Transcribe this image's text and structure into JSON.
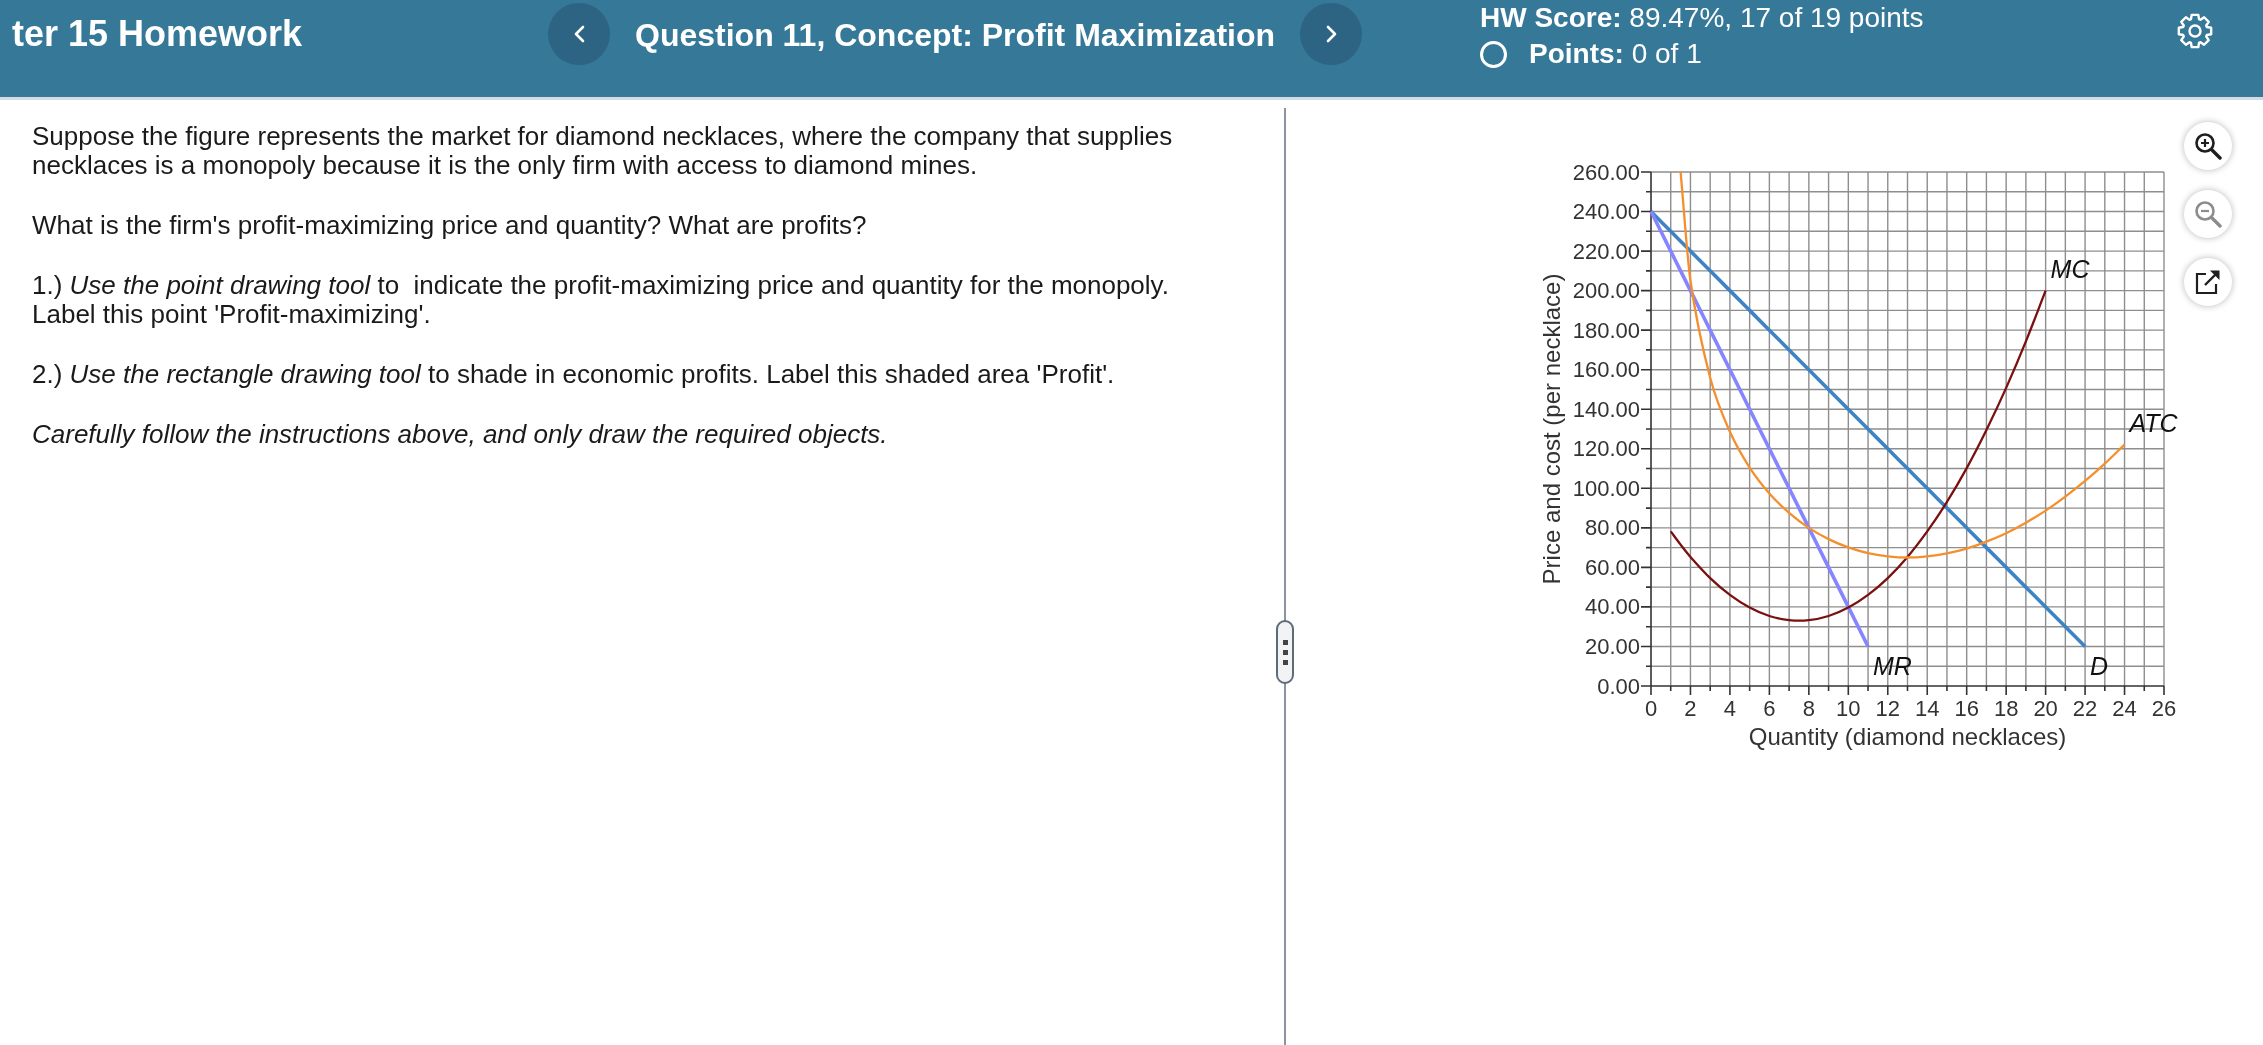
{
  "header": {
    "assignment_title": "ter 15 Homework",
    "question_title": "Question 11, Concept: Profit Maximization",
    "hw_score": "**HW Score:** 89.47%, 17 of 19 points",
    "points": "**Points:** 0 of 1"
  },
  "question": {
    "paragraphs": [
      {
        "kind": "body",
        "text": "Suppose the figure represents the market for diamond necklaces, where the company that supplies necklaces is a monopoly because it is the only firm with access to diamond mines."
      },
      {
        "kind": "body",
        "text": "What is the firm's profit-maximizing price and quantity? What are profits?"
      },
      {
        "kind": "body",
        "text": "1.) *Use the point drawing tool* to  indicate the profit-maximizing price and quantity for the monopoly. Label this point 'Profit-maximizing'."
      },
      {
        "kind": "body",
        "text": "2.) *Use the rectangle drawing tool* to shade in economic profits. Label this shaded area 'Profit'."
      },
      {
        "kind": "note",
        "text": "Carefully follow the instructions above, and only draw the required objects."
      }
    ]
  },
  "graph": {
    "chart_data": {
      "type": "line",
      "xlabel": "Quantity (diamond necklaces)",
      "ylabel": "Price and cost (per necklace)",
      "grid": true,
      "x": [
        0,
        1,
        1.5,
        2,
        3,
        4,
        5,
        6,
        7,
        8,
        9,
        10,
        11,
        12,
        13,
        14,
        15,
        16,
        17,
        18,
        19,
        20,
        21,
        22,
        23,
        24
      ],
      "xlim": [
        0,
        26
      ],
      "ylim": [
        0,
        260
      ],
      "xticks": [
        0,
        2,
        4,
        6,
        8,
        10,
        12,
        14,
        16,
        18,
        20,
        22,
        24,
        26
      ],
      "yticks": [
        {
          "value": 0,
          "label": "0.00"
        },
        {
          "value": 20,
          "label": "20.00"
        },
        {
          "value": 40,
          "label": "40.00"
        },
        {
          "value": 60,
          "label": "60.00"
        },
        {
          "value": 80,
          "label": "80.00"
        },
        {
          "value": 100,
          "label": "100.00"
        },
        {
          "value": 120,
          "label": "120.00"
        },
        {
          "value": 140,
          "label": "140.00"
        },
        {
          "value": 160,
          "label": "160.00"
        },
        {
          "value": 180,
          "label": "180.00"
        },
        {
          "value": 200,
          "label": "200.00"
        },
        {
          "value": 220,
          "label": "220.00"
        },
        {
          "value": 240,
          "label": "240.00"
        },
        {
          "value": 260,
          "label": "260.00"
        }
      ],
      "series": [
        {
          "name": "D",
          "color": "#3d84c6",
          "values": [
            240,
            230,
            225,
            220,
            210,
            200,
            190,
            180,
            170,
            160,
            150,
            140,
            130,
            120,
            110,
            100,
            90,
            80,
            70,
            60,
            50,
            40,
            30,
            20,
            null,
            null
          ]
        },
        {
          "name": "MR",
          "color": "#8585ff",
          "values": [
            240,
            220,
            210,
            200,
            180,
            160,
            140,
            120,
            100,
            80,
            60,
            40,
            20,
            null,
            null,
            null,
            null,
            null,
            null,
            null,
            null,
            null,
            null,
            null,
            null,
            null
          ]
        },
        {
          "name": "MC",
          "color": "#7a1010",
          "values": [
            null,
            78.2,
            71.5,
            65.3,
            54.6,
            46.1,
            39.7,
            35.4,
            33.3,
            33.3,
            35.4,
            39.7,
            46.1,
            54.6,
            65.3,
            78.2,
            93.1,
            110.2,
            129.5,
            150.8,
            174.3,
            200,
            null,
            null,
            null,
            null
          ]
        },
        {
          "name": "ATC",
          "color": "#f58f2e",
          "values": [
            null,
            null,
            260,
            205,
            155.9,
            128.6,
            110.5,
            97.4,
            87.6,
            80,
            74.3,
            70.1,
            67.2,
            65.6,
            65,
            65.6,
            67.1,
            69.5,
            73,
            77.3,
            82.6,
            88.7,
            95.8,
            103.7,
            112.5,
            122.1
          ]
        }
      ]
    },
    "tools": [
      {
        "kind": "zoom-in",
        "disabled": false
      },
      {
        "kind": "zoom-out",
        "disabled": true
      },
      {
        "kind": "pop-out",
        "disabled": false
      }
    ]
  }
}
